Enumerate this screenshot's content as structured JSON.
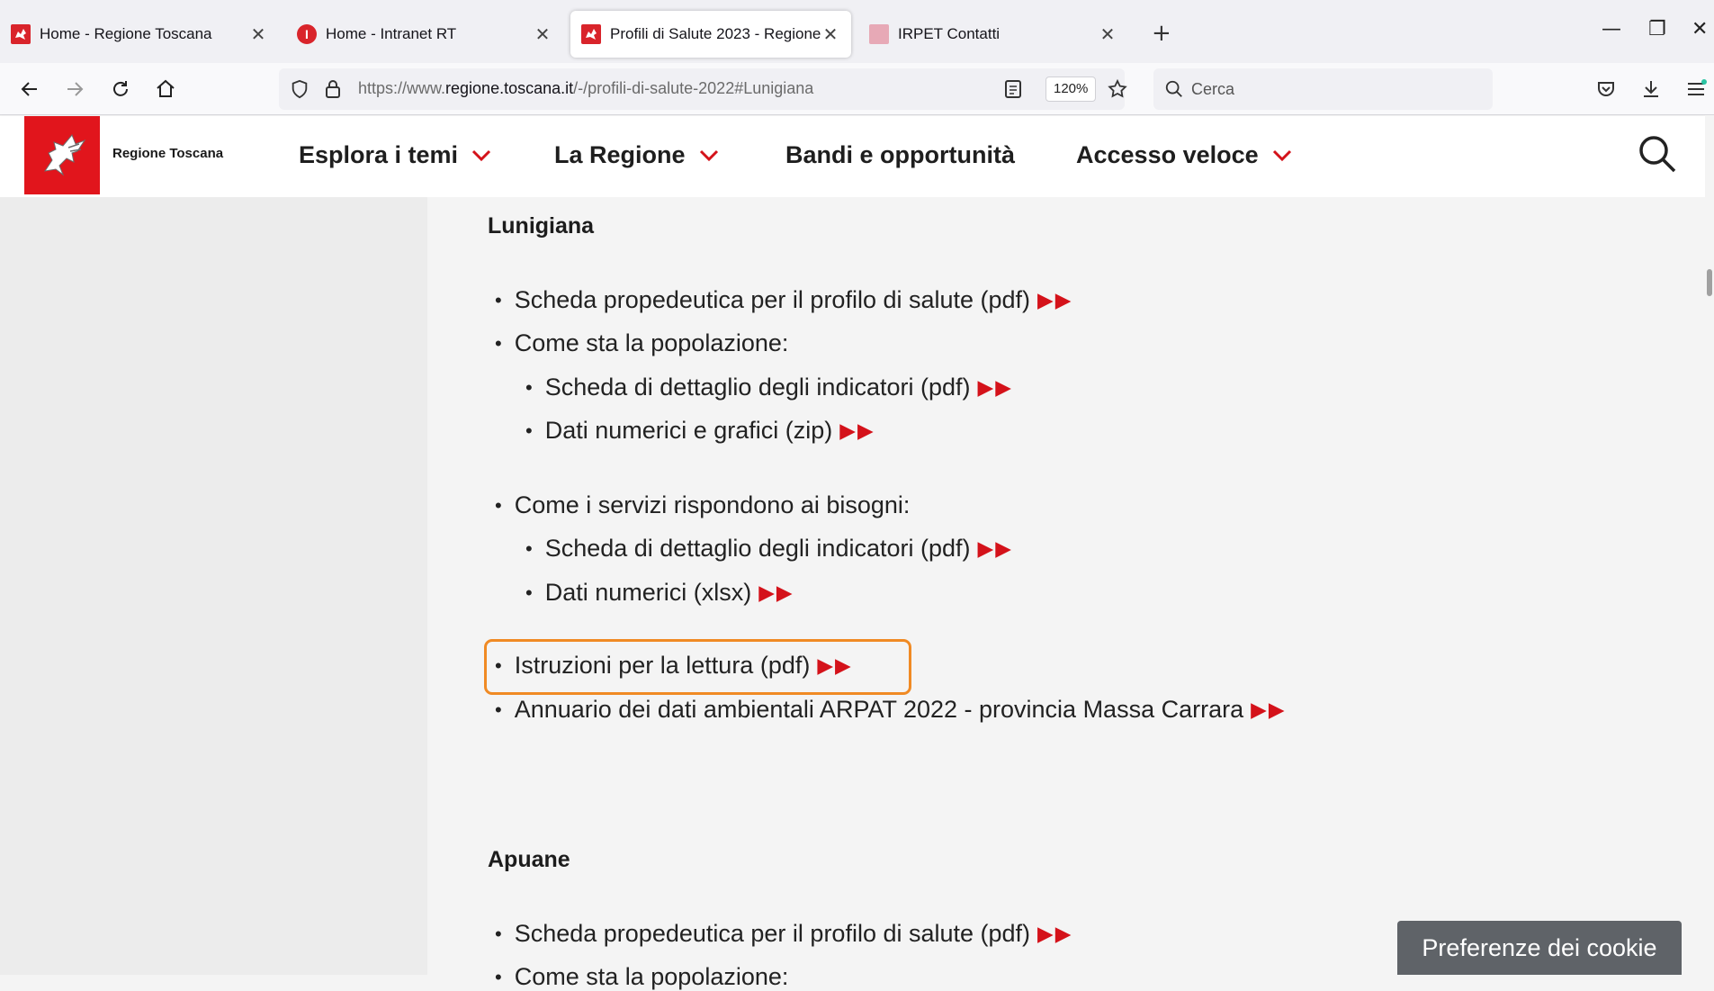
{
  "browser": {
    "tabs": [
      {
        "title": "Home - Regione Toscana",
        "close": "✕",
        "favicon": "regione-toscana-icon"
      },
      {
        "title": "Home - Intranet RT",
        "close": "✕",
        "favicon": "intranet-icon"
      },
      {
        "title": "Profili di Salute 2023 - Regione Toscana",
        "close": "✕",
        "favicon": "regione-toscana-icon",
        "active": true
      },
      {
        "title": "IRPET Contatti",
        "close": "✕",
        "favicon": "irpet-icon"
      }
    ],
    "new_tab": "+",
    "window_controls": {
      "minimize": "—",
      "restore": "❐",
      "close": "✕"
    },
    "url_prefix": "https://www.",
    "url_domain": "regione.toscana.it",
    "url_path": "/-/profili-di-salute-2022#Lunigiana",
    "zoom": "120%",
    "search_placeholder": "Cerca"
  },
  "site": {
    "logo_text": "Regione Toscana",
    "menu": [
      {
        "label": "Esplora i temi",
        "has_dropdown": true
      },
      {
        "label": "La Regione",
        "has_dropdown": true
      },
      {
        "label": "Bandi e opportunità",
        "has_dropdown": false
      },
      {
        "label": "Accesso veloce",
        "has_dropdown": true
      }
    ]
  },
  "content": {
    "bullet": "•",
    "arrows": "▶▶",
    "lunigiana": {
      "title": "Lunigiana",
      "items": [
        "Scheda propedeutica per il profilo di salute  (pdf)",
        "Come sta la popolazione:",
        "Scheda di dettaglio degli indicatori (pdf)",
        "Dati numerici e grafici (zip)",
        "Come i servizi rispondono ai bisogni:",
        "Scheda di dettaglio degli indicatori (pdf)",
        "Dati numerici (xlsx)",
        "Istruzioni per la lettura (pdf)",
        "Annuario dei dati ambientali ARPAT 2022 - provincia Massa Carrara"
      ]
    },
    "apuane": {
      "title": "Apuane",
      "items": [
        "Scheda propedeutica per il profilo di salute (pdf)",
        "Come sta la popolazione:"
      ]
    }
  },
  "cookie_button": "Preferenze dei cookie",
  "colors": {
    "accent_red": "#e1151c",
    "arrow_red": "#d4121a",
    "highlight_orange": "#f08a24"
  }
}
